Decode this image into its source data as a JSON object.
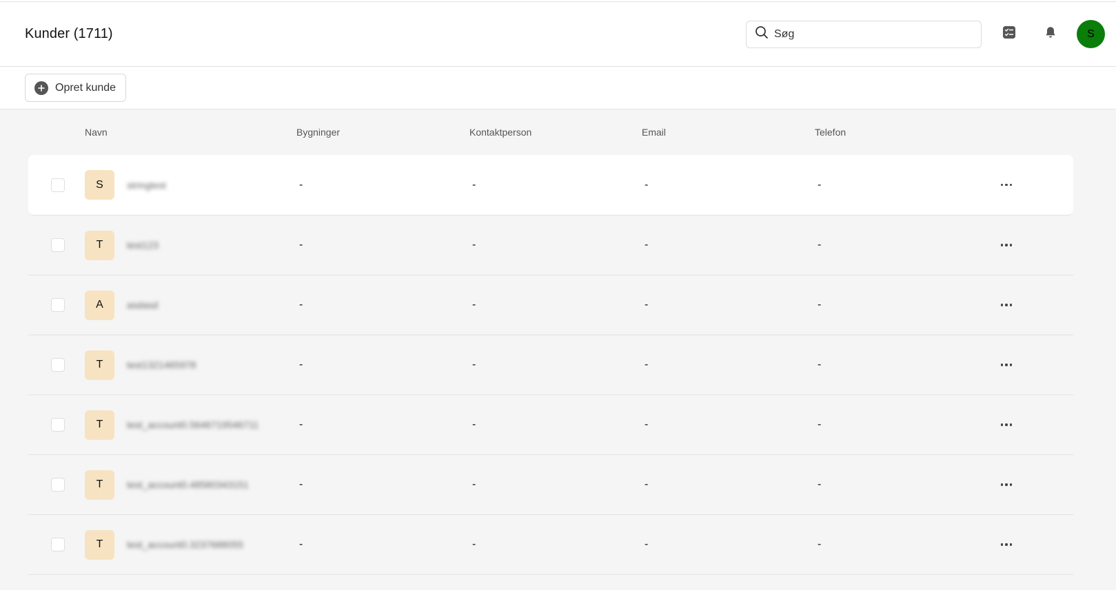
{
  "header": {
    "title": "Kunder (1711)",
    "search_placeholder": "Søg",
    "user_initial": "S",
    "icons": [
      "search-icon",
      "tasks-icon",
      "bell-icon"
    ]
  },
  "toolbar": {
    "create_label": "Opret kunde",
    "create_icon": "plus-circle-icon"
  },
  "table": {
    "columns": [
      "Navn",
      "Bygninger",
      "Kontaktperson",
      "Email",
      "Telefon"
    ],
    "rows": [
      {
        "initial": "S",
        "name": "stringtest",
        "buildings": "-",
        "contact": "-",
        "email": "-",
        "phone": "-"
      },
      {
        "initial": "T",
        "name": "test123",
        "buildings": "-",
        "contact": "-",
        "email": "-",
        "phone": "-"
      },
      {
        "initial": "A",
        "name": "asdasd",
        "buildings": "-",
        "contact": "-",
        "email": "-",
        "phone": "-"
      },
      {
        "initial": "T",
        "name": "test1321465978",
        "buildings": "-",
        "contact": "-",
        "email": "-",
        "phone": "-"
      },
      {
        "initial": "T",
        "name": "test_account0.5646719546711",
        "buildings": "-",
        "contact": "-",
        "email": "-",
        "phone": "-"
      },
      {
        "initial": "T",
        "name": "test_account0.48580343151",
        "buildings": "-",
        "contact": "-",
        "email": "-",
        "phone": "-"
      },
      {
        "initial": "T",
        "name": "test_account0.3237688055",
        "buildings": "-",
        "contact": "-",
        "email": "-",
        "phone": "-"
      }
    ]
  },
  "colors": {
    "avatar_bg": "#0a7d0a",
    "initial_bg": "#f7e3c2",
    "page_bg": "#f5f5f5"
  }
}
